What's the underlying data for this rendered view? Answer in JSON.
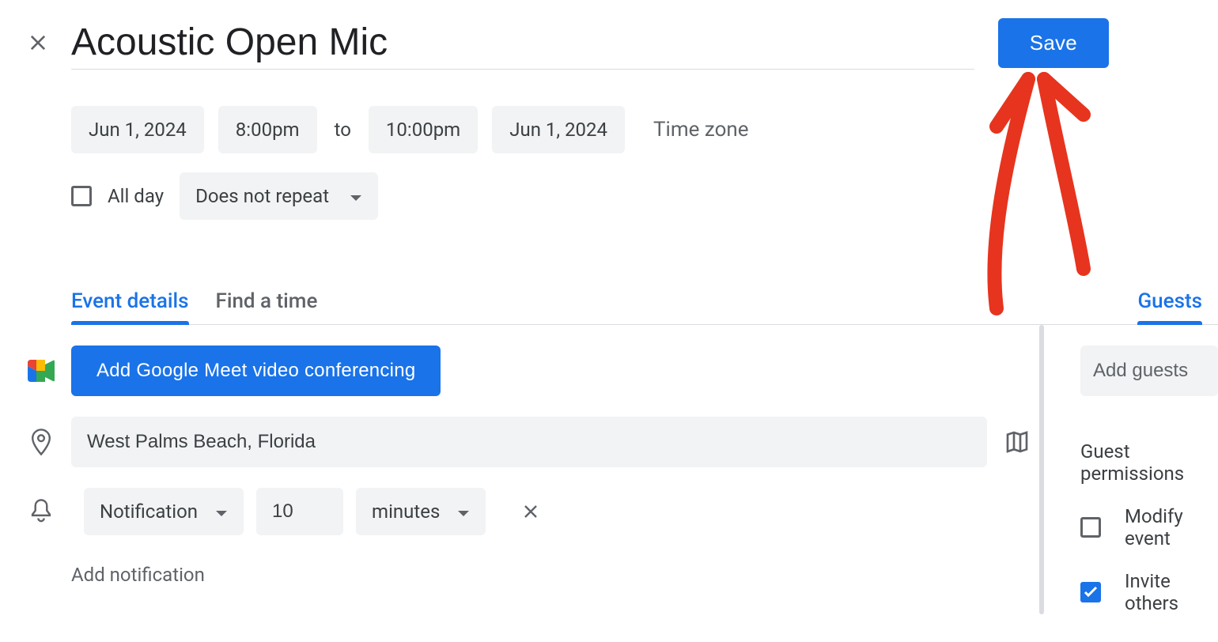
{
  "header": {
    "title": "Acoustic Open Mic",
    "save_label": "Save"
  },
  "datetime": {
    "start_date": "Jun 1, 2024",
    "start_time": "8:00pm",
    "to_label": "to",
    "end_time": "10:00pm",
    "end_date": "Jun 1, 2024",
    "timezone_label": "Time zone"
  },
  "options": {
    "all_day_label": "All day",
    "all_day_checked": false,
    "repeat_label": "Does not repeat"
  },
  "tabs": {
    "event_details": "Event details",
    "find_a_time": "Find a time",
    "guests": "Guests"
  },
  "details": {
    "meet_button": "Add Google Meet video conferencing",
    "location": "West Palms Beach, Florida",
    "notification": {
      "type_label": "Notification",
      "value": "10",
      "unit_label": "minutes"
    },
    "add_notification_label": "Add notification"
  },
  "guests_panel": {
    "add_guests_placeholder": "Add guests",
    "permissions_title": "Guest permissions",
    "modify_event_label": "Modify event",
    "modify_event_checked": false,
    "invite_others_label": "Invite others",
    "invite_others_checked": true
  },
  "colors": {
    "primary": "#1a73e8",
    "annotation": "#e7341e"
  }
}
